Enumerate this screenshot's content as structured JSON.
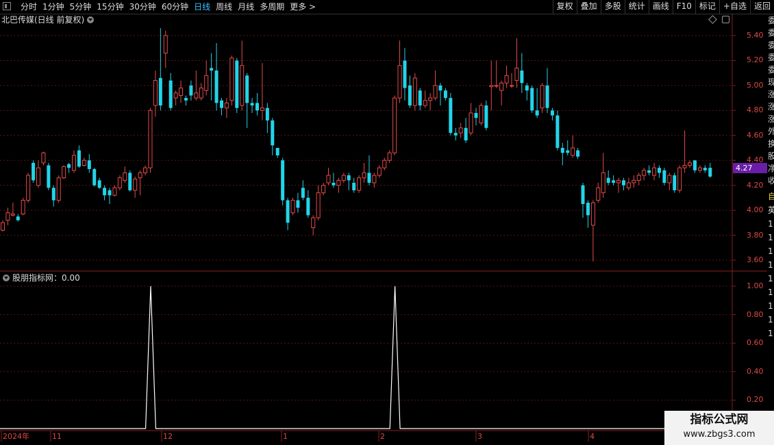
{
  "toolbar": {
    "periods": [
      "分时",
      "1分钟",
      "5分钟",
      "15分钟",
      "30分钟",
      "60分钟",
      "日线",
      "周线",
      "月线",
      "多周期",
      "更多 >"
    ],
    "active_period": "日线",
    "tools": [
      "复权",
      "叠加",
      "多股",
      "统计",
      "画线",
      "F10",
      "标记",
      "+自选",
      "返回"
    ]
  },
  "main_chart": {
    "title": "北巴传媒(日线 前复权)",
    "y_axis_labels": [
      "5.40",
      "5.20",
      "5.00",
      "4.80",
      "4.60",
      "4.40",
      "4.20",
      "4.00",
      "3.80",
      "3.60"
    ],
    "current_price": "4.27",
    "colors": {
      "up": "#e84b4b",
      "down": "#22d4e8",
      "bg": "#000000",
      "grid": "#5a1414",
      "price_tag": "#6a1ea8"
    }
  },
  "indicator": {
    "title": "股朋指标网：0.00",
    "y_axis_labels": [
      "1.00",
      "0.80",
      "0.60",
      "0.40",
      "0.20"
    ],
    "line_color": "#ffffff"
  },
  "x_axis": {
    "labels": [
      "2024年",
      "11",
      "12",
      "1",
      "2",
      "3",
      "4"
    ]
  },
  "right_strip": [
    "委",
    "委",
    "委",
    "委",
    "委",
    "现",
    "涨",
    "涨",
    "涨",
    "外",
    "换",
    "股",
    "净",
    "收"
  ],
  "right_strip_lower": [
    "自",
    "英",
    "1",
    "1",
    "1",
    "1",
    "1",
    "1",
    "1",
    "1",
    "1"
  ],
  "watermark": {
    "line1": "指标公式网",
    "line2": "www.zbgs3.com"
  },
  "chart_data": {
    "type": "candlestick",
    "ylim": [
      3.5,
      5.5
    ],
    "candles": [
      [
        3.84,
        3.9,
        3.83,
        3.92
      ],
      [
        3.92,
        3.98,
        3.88,
        4.02
      ],
      [
        3.96,
        3.97,
        3.95,
        4.06
      ],
      [
        3.95,
        3.92,
        3.91,
        3.97
      ],
      [
        3.97,
        4.08,
        3.96,
        4.1
      ],
      [
        4.08,
        4.28,
        4.06,
        4.3
      ],
      [
        4.38,
        4.24,
        4.22,
        4.4
      ],
      [
        4.2,
        4.34,
        4.18,
        4.4
      ],
      [
        4.38,
        4.46,
        4.36,
        4.47
      ],
      [
        4.36,
        4.18,
        4.16,
        4.38
      ],
      [
        4.18,
        4.08,
        4.03,
        4.2
      ],
      [
        4.08,
        4.26,
        4.06,
        4.28
      ],
      [
        4.26,
        4.35,
        4.25,
        4.36
      ],
      [
        4.37,
        4.34,
        4.3,
        4.38
      ],
      [
        4.32,
        4.44,
        4.3,
        4.48
      ],
      [
        4.48,
        4.35,
        4.34,
        4.52
      ],
      [
        4.36,
        4.4,
        4.35,
        4.42
      ],
      [
        4.4,
        4.33,
        4.3,
        4.45
      ],
      [
        4.33,
        4.2,
        4.19,
        4.34
      ],
      [
        4.24,
        4.18,
        4.17,
        4.26
      ],
      [
        4.18,
        4.12,
        4.08,
        4.2
      ],
      [
        4.16,
        4.12,
        4.05,
        4.18
      ],
      [
        4.12,
        4.18,
        4.11,
        4.2
      ],
      [
        4.18,
        4.26,
        4.16,
        4.28
      ],
      [
        4.24,
        4.3,
        4.22,
        4.35
      ],
      [
        4.3,
        4.16,
        4.15,
        4.32
      ],
      [
        4.16,
        4.25,
        4.1,
        4.27
      ],
      [
        4.26,
        4.3,
        4.12,
        4.32
      ],
      [
        4.3,
        4.34,
        4.28,
        4.36
      ],
      [
        4.34,
        4.8,
        4.3,
        4.82
      ],
      [
        4.84,
        5.04,
        4.75,
        5.12
      ],
      [
        5.06,
        4.84,
        4.8,
        5.46
      ],
      [
        5.26,
        5.4,
        5.14,
        5.44
      ],
      [
        5.04,
        4.82,
        4.8,
        5.1
      ],
      [
        4.9,
        4.94,
        4.84,
        4.96
      ],
      [
        4.92,
        4.98,
        4.86,
        5.04
      ],
      [
        4.9,
        4.88,
        4.84,
        4.92
      ],
      [
        5.0,
        4.92,
        4.88,
        5.04
      ],
      [
        4.9,
        4.94,
        4.88,
        5.12
      ],
      [
        4.9,
        4.98,
        4.88,
        5.02
      ],
      [
        4.96,
        5.08,
        4.92,
        5.2
      ],
      [
        5.14,
        5.12,
        4.88,
        5.26
      ],
      [
        5.12,
        4.86,
        4.8,
        5.34
      ],
      [
        4.88,
        4.82,
        4.76,
        4.9
      ],
      [
        4.82,
        4.86,
        4.74,
        4.9
      ],
      [
        4.88,
        5.22,
        4.84,
        5.24
      ],
      [
        5.2,
        4.82,
        4.78,
        5.22
      ],
      [
        4.84,
        5.16,
        4.8,
        5.36
      ],
      [
        5.08,
        4.86,
        4.66,
        5.1
      ],
      [
        4.86,
        4.84,
        4.78,
        4.9
      ],
      [
        4.86,
        4.8,
        4.76,
        4.94
      ],
      [
        4.8,
        4.82,
        4.72,
        5.18
      ],
      [
        4.82,
        4.72,
        4.62,
        4.86
      ],
      [
        4.72,
        4.52,
        4.44,
        4.74
      ],
      [
        4.5,
        4.44,
        4.42,
        4.48
      ],
      [
        4.4,
        4.08,
        4.04,
        4.42
      ],
      [
        4.08,
        3.9,
        3.84,
        4.1
      ],
      [
        3.98,
        4.08,
        3.96,
        4.1
      ],
      [
        4.08,
        4.02,
        3.98,
        4.14
      ],
      [
        4.18,
        4.1,
        4.08,
        4.24
      ],
      [
        4.1,
        3.96,
        3.94,
        4.16
      ],
      [
        3.86,
        3.94,
        3.8,
        3.96
      ],
      [
        3.94,
        4.14,
        3.92,
        4.2
      ],
      [
        4.14,
        4.2,
        4.12,
        4.22
      ],
      [
        4.22,
        4.28,
        4.2,
        4.34
      ],
      [
        4.22,
        4.2,
        4.18,
        4.3
      ],
      [
        4.2,
        4.24,
        4.14,
        4.26
      ],
      [
        4.24,
        4.28,
        4.22,
        4.3
      ],
      [
        4.28,
        4.24,
        4.16,
        4.3
      ],
      [
        4.22,
        4.16,
        4.14,
        4.26
      ],
      [
        4.16,
        4.26,
        4.14,
        4.28
      ],
      [
        4.26,
        4.3,
        4.22,
        4.38
      ],
      [
        4.3,
        4.22,
        4.2,
        4.44
      ],
      [
        4.22,
        4.28,
        4.18,
        4.3
      ],
      [
        4.28,
        4.34,
        4.26,
        4.36
      ],
      [
        4.34,
        4.4,
        4.32,
        4.42
      ],
      [
        4.4,
        4.46,
        4.38,
        4.48
      ],
      [
        4.46,
        4.9,
        4.44,
        4.92
      ],
      [
        4.9,
        5.16,
        4.86,
        5.36
      ],
      [
        5.2,
        4.98,
        4.88,
        5.3
      ],
      [
        5.0,
        4.84,
        4.82,
        5.08
      ],
      [
        4.84,
        5.06,
        4.8,
        5.1
      ],
      [
        4.96,
        4.84,
        4.8,
        4.98
      ],
      [
        4.84,
        4.88,
        4.82,
        4.96
      ],
      [
        4.88,
        4.9,
        4.8,
        4.94
      ],
      [
        4.9,
        5.0,
        4.88,
        5.12
      ],
      [
        5.0,
        4.96,
        4.84,
        5.02
      ],
      [
        4.96,
        4.9,
        4.88,
        4.98
      ],
      [
        4.9,
        4.62,
        4.6,
        4.94
      ],
      [
        4.62,
        4.6,
        4.56,
        4.66
      ],
      [
        4.62,
        4.66,
        4.58,
        4.7
      ],
      [
        4.66,
        4.56,
        4.54,
        4.74
      ],
      [
        4.62,
        4.78,
        4.6,
        4.86
      ],
      [
        4.78,
        4.74,
        4.68,
        4.82
      ],
      [
        4.7,
        4.84,
        4.68,
        4.86
      ],
      [
        4.84,
        4.66,
        4.64,
        4.88
      ],
      [
        4.99,
        5.0,
        4.8,
        5.2
      ],
      [
        5.0,
        5.0,
        4.98,
        5.2
      ],
      [
        4.96,
        5.02,
        4.84,
        5.04
      ],
      [
        5.02,
        5.08,
        4.98,
        5.16
      ],
      [
        5.0,
        5.0,
        4.98,
        5.1
      ],
      [
        5.04,
        5.14,
        4.98,
        5.38
      ],
      [
        5.12,
        5.02,
        4.94,
        5.26
      ],
      [
        5.0,
        4.96,
        4.88,
        5.02
      ],
      [
        4.98,
        4.8,
        4.78,
        5.0
      ],
      [
        4.8,
        4.76,
        4.74,
        4.98
      ],
      [
        4.82,
        5.0,
        4.78,
        5.02
      ],
      [
        5.0,
        4.82,
        4.78,
        5.14
      ],
      [
        4.8,
        4.76,
        4.72,
        4.82
      ],
      [
        4.76,
        4.5,
        4.48,
        4.8
      ],
      [
        4.5,
        4.46,
        4.36,
        4.54
      ],
      [
        4.48,
        4.46,
        4.44,
        4.56
      ],
      [
        4.44,
        4.5,
        4.42,
        4.6
      ],
      [
        4.48,
        4.43,
        4.41,
        4.5
      ],
      [
        4.2,
        4.05,
        3.94,
        4.22
      ],
      [
        4.06,
        3.96,
        3.86,
        4.08
      ],
      [
        3.88,
        4.06,
        3.59,
        4.08
      ],
      [
        4.08,
        4.18,
        4.06,
        4.22
      ],
      [
        4.14,
        4.3,
        4.1,
        4.46
      ],
      [
        4.26,
        4.22,
        4.2,
        4.32
      ],
      [
        4.24,
        4.22,
        4.2,
        4.28
      ],
      [
        4.22,
        4.24,
        4.14,
        4.26
      ],
      [
        4.24,
        4.2,
        4.16,
        4.26
      ],
      [
        4.18,
        4.22,
        4.16,
        4.26
      ],
      [
        4.22,
        4.24,
        4.18,
        4.28
      ],
      [
        4.24,
        4.28,
        4.2,
        4.3
      ],
      [
        4.28,
        4.32,
        4.24,
        4.34
      ],
      [
        4.32,
        4.3,
        4.28,
        4.36
      ],
      [
        4.28,
        4.34,
        4.24,
        4.38
      ],
      [
        4.34,
        4.3,
        4.26,
        4.36
      ],
      [
        4.32,
        4.22,
        4.2,
        4.34
      ],
      [
        4.22,
        4.28,
        4.16,
        4.3
      ],
      [
        4.28,
        4.16,
        4.14,
        4.3
      ],
      [
        4.16,
        4.34,
        4.14,
        4.36
      ],
      [
        4.34,
        4.36,
        4.3,
        4.64
      ],
      [
        4.36,
        4.38,
        4.34,
        4.4
      ],
      [
        4.4,
        4.32,
        4.3,
        4.4
      ],
      [
        4.32,
        4.34,
        4.3,
        4.36
      ],
      [
        4.34,
        4.32,
        4.3,
        4.36
      ],
      [
        4.34,
        4.27,
        4.26,
        4.38
      ]
    ],
    "indicator": {
      "type": "line",
      "ylim": [
        0,
        1.1
      ],
      "spikes_at_candle": [
        29,
        77
      ],
      "values_desc": "0 everywhere except value 1.00 at spike candles"
    }
  }
}
